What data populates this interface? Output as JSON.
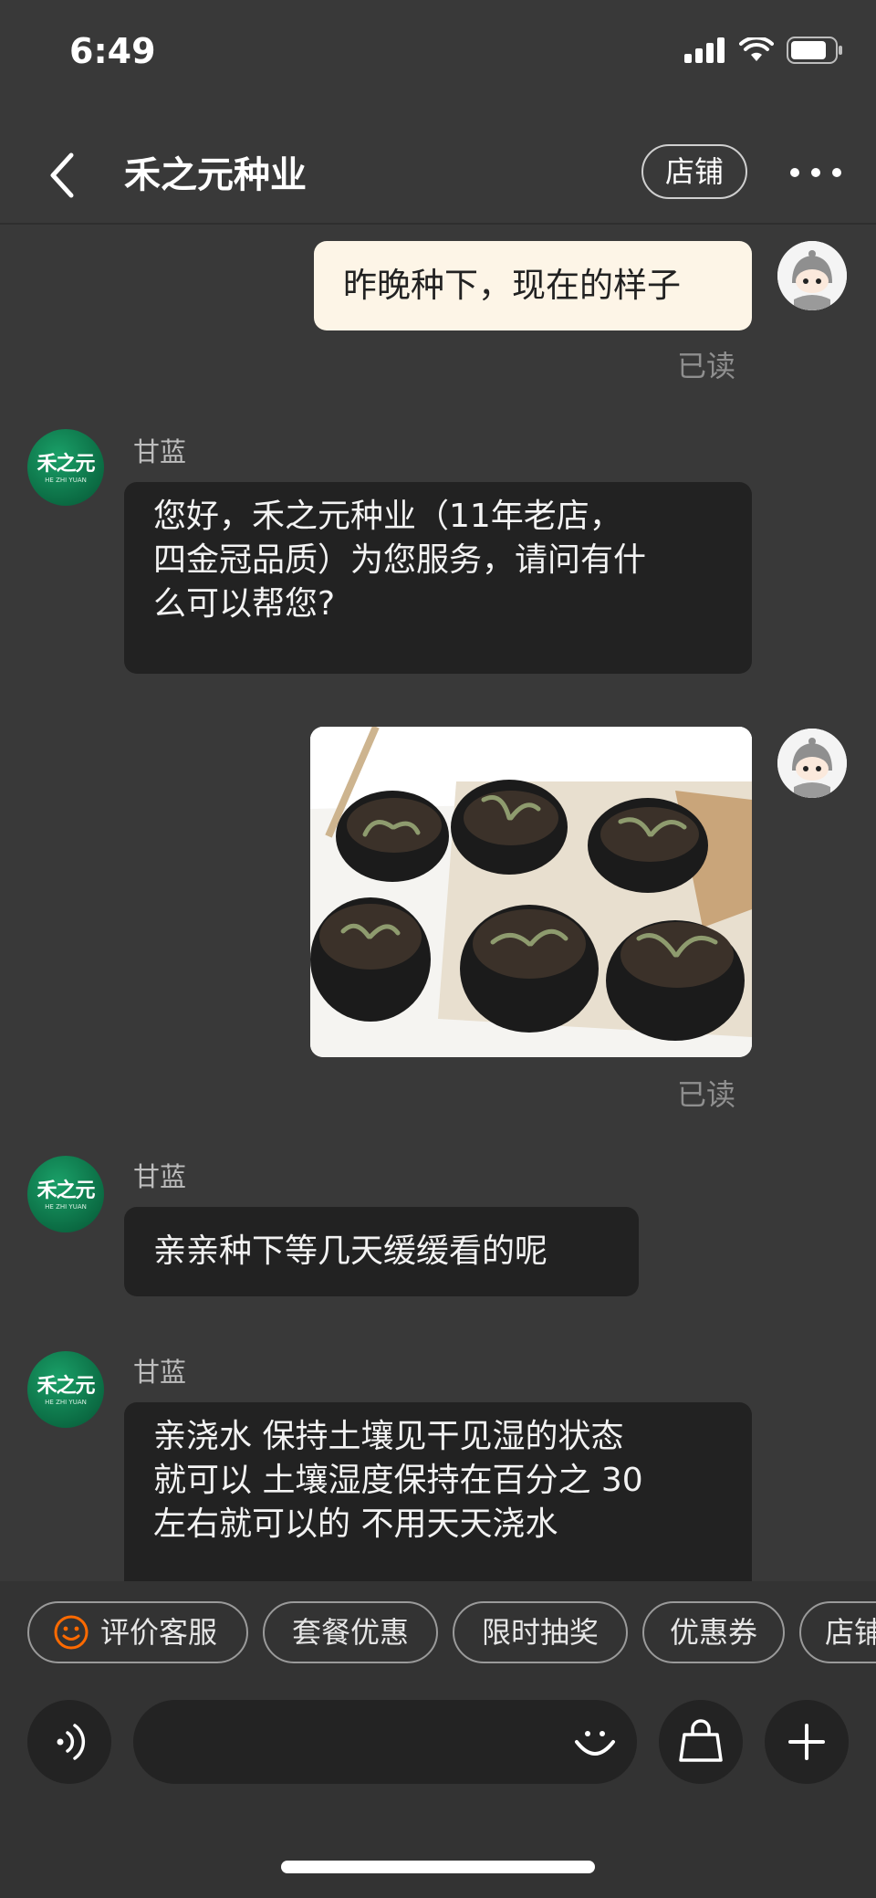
{
  "status": {
    "time": "6:49"
  },
  "header": {
    "title": "禾之元种业",
    "shop_label": "店铺"
  },
  "messages": [
    {
      "from": "me",
      "text": "昨晚种下，现在的样子",
      "read": "已读"
    },
    {
      "from": "shop",
      "sender": "甘蓝",
      "lines": [
        "您好，禾之元种业（11年老店，",
        "四金冠品质）为您服务，请问有什",
        "么可以帮您?"
      ]
    },
    {
      "from": "me",
      "type": "image",
      "read": "已读"
    },
    {
      "from": "shop",
      "sender": "甘蓝",
      "text": "亲亲种下等几天缓缓看的呢"
    },
    {
      "from": "shop",
      "sender": "甘蓝",
      "lines": [
        "亲浇水 保持土壤见干见湿的状态",
        "就可以 土壤湿度保持在百分之 30",
        "左右就可以的  不用天天浇水"
      ]
    }
  ],
  "shop_avatar": {
    "logo": "禾之元",
    "sub": "HE ZHI YUAN"
  },
  "quick_actions": [
    "评价客服",
    "套餐优惠",
    "限时抽奖",
    "优惠券",
    "店铺"
  ],
  "icons": {
    "back": "chevron-left-icon",
    "more": "more-dots-icon",
    "voice": "voice-icon",
    "emoji": "smile-icon",
    "bag": "shopping-bag-icon",
    "plus": "plus-icon"
  },
  "colors": {
    "background": "#393939",
    "my_bubble": "#fdf5e7",
    "their_bubble": "#222222",
    "accent": "#ff6a00"
  }
}
